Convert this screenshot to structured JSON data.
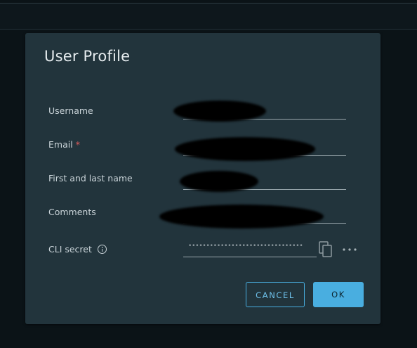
{
  "dialog": {
    "title": "User Profile",
    "fields": [
      {
        "label": "Username",
        "required": false,
        "value": ""
      },
      {
        "label": "Email",
        "required": true,
        "required_marker": "*",
        "value": ""
      },
      {
        "label": "First and last name",
        "required": false,
        "value": ""
      },
      {
        "label": "Comments",
        "required": false,
        "value": ""
      }
    ],
    "cli_secret": {
      "label": "CLI secret",
      "masked_value": "••••••••••••••••••••••••••••••••",
      "info_icon": "info-icon",
      "copy_icon": "copy-icon",
      "more_icon": "more-options-icon"
    },
    "buttons": {
      "cancel": "CANCEL",
      "ok": "OK"
    }
  },
  "colors": {
    "dialog_bg": "#22343c",
    "page_bg": "#0b1317",
    "accent": "#49aee0",
    "required": "#e05c5c"
  }
}
